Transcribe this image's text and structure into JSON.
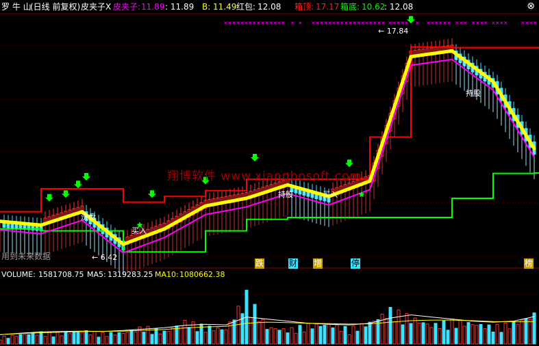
{
  "header": {
    "stock_name": "罗 牛 山",
    "period": "(日线 前复权)",
    "indicator_name": "皮夹子X",
    "pjz_label": "皮夹子:",
    "pjz_value": "11.89",
    "pjz_close": ": 11.89",
    "b_label": "B:",
    "b_value": "11.49",
    "hongbao_label": "红包:",
    "hongbao_value": "12.08",
    "box_top_label": "箱顶:",
    "box_top_value": "17.17",
    "box_bottom_label": "箱底:",
    "box_bottom_value": "10.62",
    "box_close": ": 12.08",
    "close_icon": "close-icon"
  },
  "annotations": {
    "high_price": "17.84",
    "low_price": "6.42",
    "buy_label_1": "买入",
    "buy_label_2": "买入",
    "hold_label_1": "洗盘",
    "hold_label_2": "持股",
    "hold_label_3": "持股",
    "future_note": "用到未来数据",
    "watermark": "翔博软件 www.xiangbosoft.com",
    "signals": [
      "跌",
      "财",
      "增",
      "停",
      "榜"
    ]
  },
  "volume_header": {
    "volume_label": "VOLUME:",
    "volume_value": "1581708.75",
    "ma5_label": "MA5:",
    "ma5_value": "1319283.25",
    "ma10_label": "MA10:",
    "ma10_value": "1080662.38"
  },
  "colors": {
    "up": "#ff3030",
    "down": "#40e0ff",
    "yellow": "#ffff00",
    "magenta": "#ff00ff",
    "green": "#00ff00",
    "box_top": "#ff0000"
  },
  "chart_data": [
    {
      "type": "line",
      "title": "皮夹子X",
      "x": [
        0,
        10,
        20,
        30,
        40,
        50,
        60,
        70,
        80,
        90,
        100,
        110,
        120,
        130
      ],
      "series": [
        {
          "name": "皮夹子",
          "values": [
            8.1,
            7.9,
            8.6,
            6.9,
            7.7,
            8.9,
            9.3,
            10.0,
            9.4,
            10.2,
            16.7,
            17.0,
            15.4,
            11.9
          ]
        },
        {
          "name": "箱顶",
          "values": [
            8.6,
            9.8,
            9.8,
            9.1,
            9.4,
            9.7,
            10.3,
            10.3,
            10.3,
            12.5,
            17.2,
            17.17,
            17.17,
            17.17
          ]
        },
        {
          "name": "箱底",
          "values": [
            7.7,
            7.6,
            7.6,
            6.5,
            6.5,
            7.6,
            8.2,
            8.3,
            8.3,
            8.3,
            8.3,
            9.3,
            10.6,
            10.62
          ]
        }
      ],
      "ylim": [
        5.8,
        18.8
      ]
    },
    {
      "type": "bar",
      "title": "VOLUME",
      "x": [
        0,
        5,
        10,
        15,
        20,
        25,
        30,
        35,
        40,
        45,
        50,
        55,
        60,
        65,
        70,
        75,
        80,
        85,
        90,
        95,
        100,
        105,
        110,
        115,
        120,
        125,
        130
      ],
      "values": [
        0.35,
        0.5,
        0.6,
        0.55,
        0.7,
        0.55,
        0.6,
        0.9,
        0.65,
        1.2,
        0.9,
        0.8,
        2.6,
        0.9,
        0.75,
        1.0,
        1.05,
        0.8,
        1.15,
        1.8,
        1.4,
        1.0,
        1.2,
        1.1,
        0.9,
        1.1,
        1.58
      ],
      "series": [
        {
          "name": "MA5",
          "values": [
            0.45,
            0.52,
            0.58,
            0.6,
            0.62,
            0.6,
            0.65,
            0.72,
            0.78,
            0.9,
            0.95,
            0.92,
            1.3,
            1.2,
            1.1,
            1.0,
            0.95,
            0.92,
            1.0,
            1.25,
            1.4,
            1.3,
            1.2,
            1.1,
            1.05,
            1.1,
            1.32
          ]
        },
        {
          "name": "MA10",
          "values": [
            0.45,
            0.5,
            0.54,
            0.57,
            0.6,
            0.61,
            0.62,
            0.66,
            0.7,
            0.77,
            0.82,
            0.85,
            1.0,
            1.05,
            1.03,
            1.0,
            0.98,
            0.96,
            0.97,
            1.05,
            1.12,
            1.15,
            1.15,
            1.12,
            1.08,
            1.07,
            1.08
          ]
        }
      ],
      "ylim": [
        0,
        3.0
      ]
    }
  ]
}
